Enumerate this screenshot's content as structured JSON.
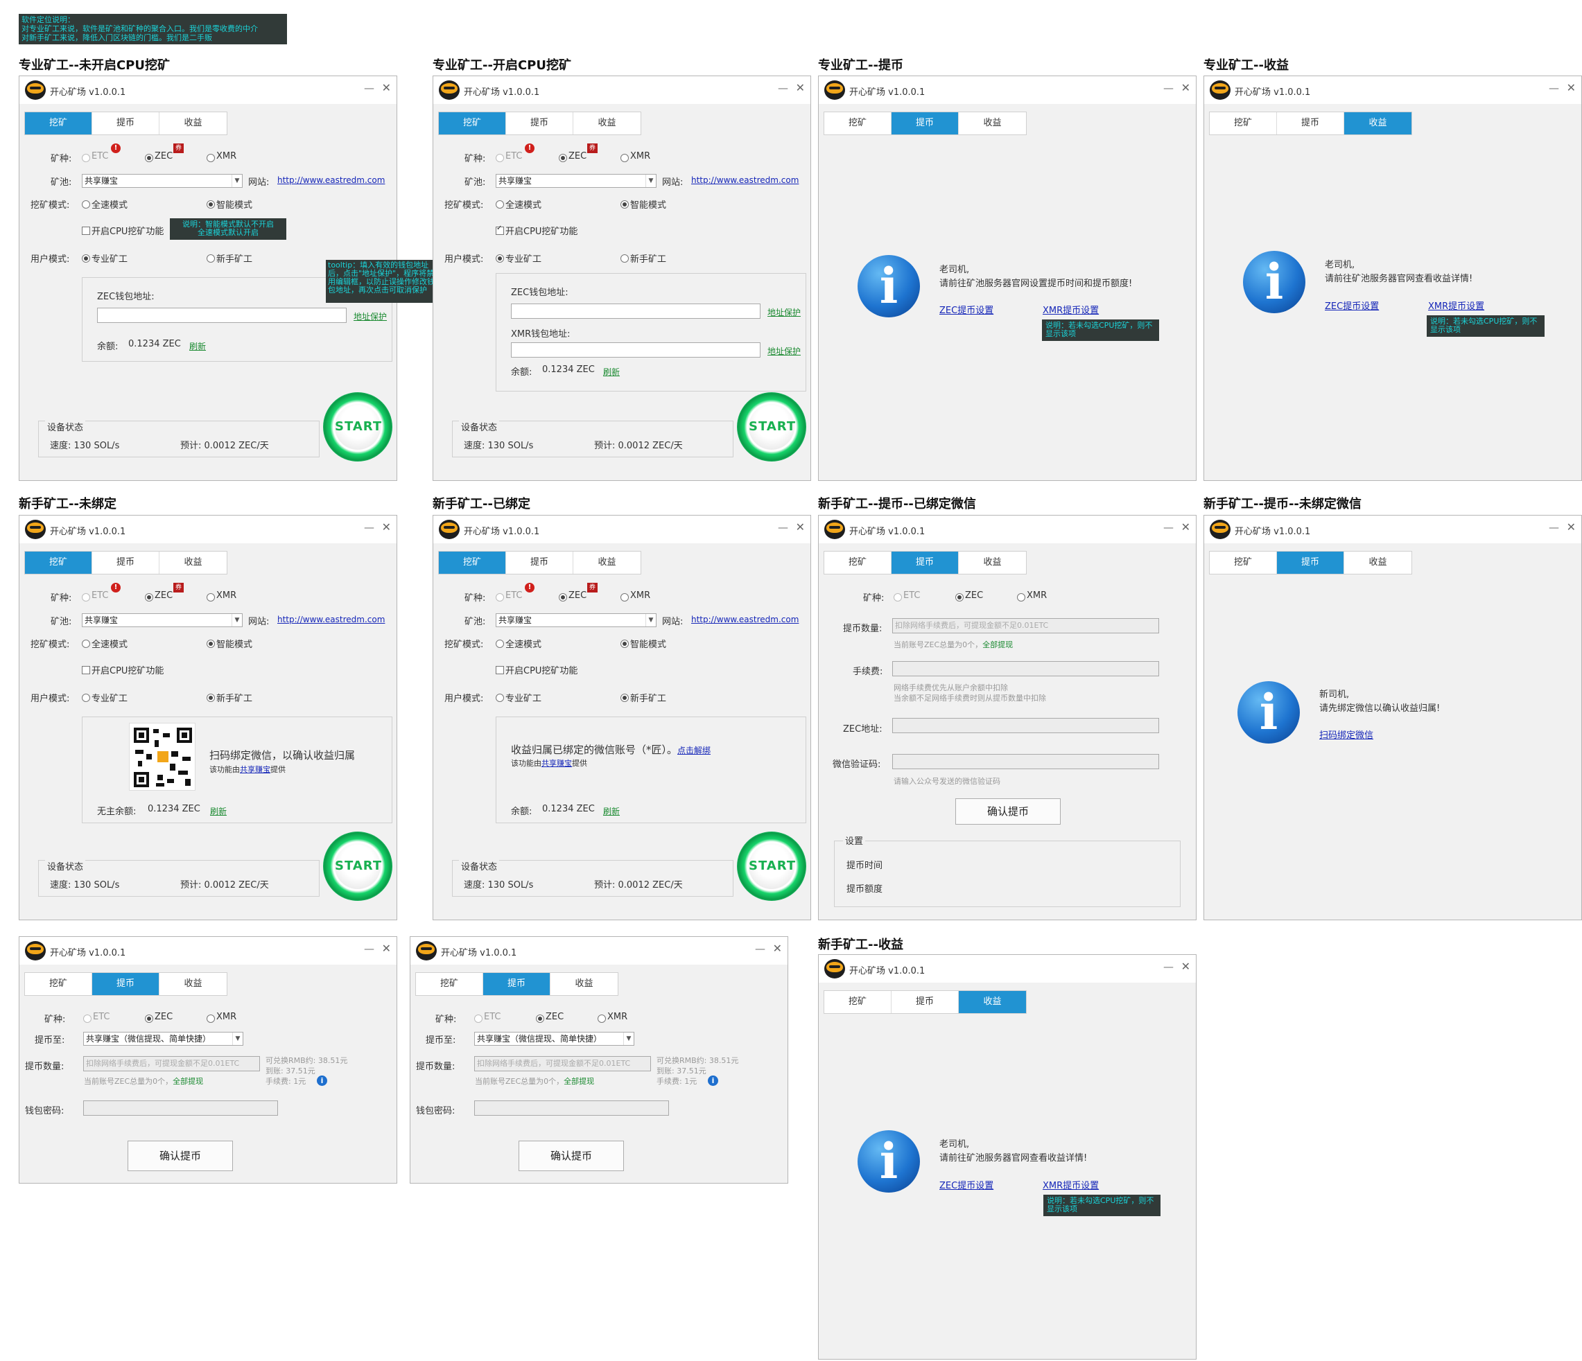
{
  "top_note": "软件定位说明：\n对专业矿工来说，软件是矿池和矿种的聚合入口。我们是零收费的中介\n对新手矿工来说，降低入门区块链的门槛。我们是二手贩",
  "app_title": "开心矿场 v1.0.0.1",
  "tabs": [
    "挖矿",
    "提币",
    "收益"
  ],
  "mine": {
    "coin_label": "矿种:",
    "coins": [
      "ETC",
      "ZEC",
      "XMR"
    ],
    "pool_label": "矿池:",
    "pool_value": "共享赚宝",
    "site_label": "网站:",
    "site_url": "http://www.eastredm.com",
    "mode_label": "挖矿模式:",
    "mode_full": "全速模式",
    "mode_smart": "智能模式",
    "cpu_label": "开启CPU挖矿功能",
    "user_label": "用户模式:",
    "user_pro": "专业矿工",
    "user_new": "新手矿工",
    "zec_wallet": "ZEC钱包地址:",
    "xmr_wallet": "XMR钱包地址:",
    "addr_protect": "地址保护",
    "balance_label": "余额:",
    "balance_value": "0.1234 ZEC",
    "refresh": "刷新",
    "unowned_balance": "无主余额:",
    "device_status": "设备状态",
    "speed": "速度:  130 SOL/s",
    "estimate": "预计:  0.0012 ZEC/天",
    "start": "START",
    "badge_new": "!",
    "badge_coupon": "券"
  },
  "notes": {
    "smart": "说明：智能模式默认不开启\n全速模式默认开启",
    "tooltip": "tooltip：填入有效的钱包地址后，点击\"地址保护\"，程序将禁用编辑框，以防止误操作修改钱包地址，再次点击可取消保护",
    "no_cpu": "说明：若未勾选CPU挖矿，则不显示该项"
  },
  "panel_titles": {
    "p1": "专业矿工--未开启CPU挖矿",
    "p2": "专业矿工--开启CPU挖矿",
    "p3": "专业矿工--提币",
    "p4": "专业矿工--收益",
    "p5": "新手矿工--未绑定",
    "p6": "新手矿工--已绑定",
    "p7": "新手矿工--提币--已绑定微信",
    "p8": "新手矿工--提币--未绑定微信",
    "p11": "新手矿工--收益"
  },
  "info_pro": {
    "greeting": "老司机,",
    "withdraw_msg": "请前往矿池服务器官网设置提币时间和提币额度!",
    "earn_msg": "请前往矿池服务器官网查看收益详情!",
    "zec_link": "ZEC提币设置",
    "xmr_link": "XMR提币设置"
  },
  "info_new": {
    "greeting": "新司机,",
    "msg": "请先绑定微信以确认收益归属!",
    "link": "扫码绑定微信"
  },
  "bind": {
    "scan_msg": "扫码绑定微信，以确认收益归属",
    "provided_pre": "该功能由",
    "provider": "共享赚宝",
    "provided_post": "提供",
    "bound_msg": "收益归属已绑定的微信账号（*匠）。",
    "unbind": "点击解绑"
  },
  "withdraw": {
    "amount_label": "提币数量:",
    "amount_placeholder": "扣除网络手续费后，可提现金额不足0.01ETC",
    "total_hint": "当前账号ZEC总量为0个，",
    "withdraw_all": "全部提现",
    "fee_label": "手续费:",
    "fee_hint1": "网络手续费优先从账户余额中扣除",
    "fee_hint2": "当余额不足网络手续费时则从提币数量中扣除",
    "addr_label": "ZEC地址:",
    "code_label": "微信验证码:",
    "code_hint": "请输入公众号发送的微信验证码",
    "confirm": "确认提币",
    "settings": "设置",
    "time": "提币时间",
    "limit": "提币额度",
    "to_label": "提币至:",
    "to_value": "共享赚宝（微信提现、简单快捷）",
    "rmb": "可兑换RMB约:  38.51元",
    "arrive": "到账:  37.51元",
    "fee_small": "手续费:    1元",
    "pwd_label": "钱包密码:",
    "info_icon": "i"
  }
}
